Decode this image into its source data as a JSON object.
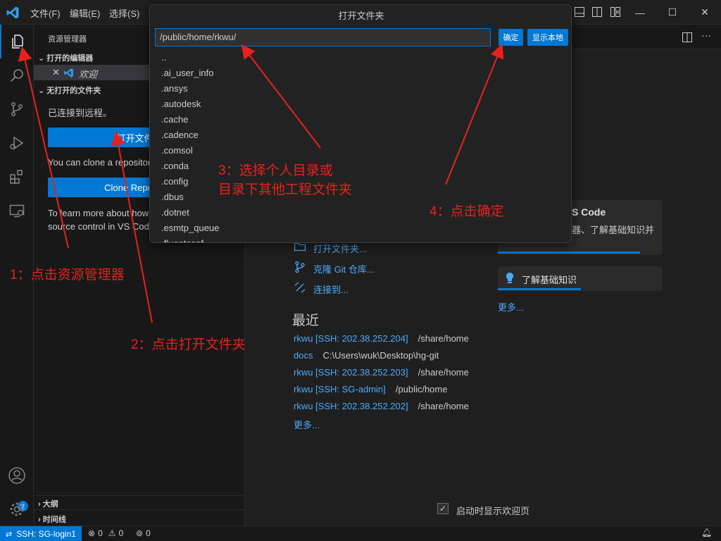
{
  "titlebar": {
    "menus": [
      "文件(F)",
      "编辑(E)",
      "选择(S)"
    ],
    "minimize": "—",
    "maximize": "☐",
    "close": "✕"
  },
  "sidebar": {
    "title": "资源管理器",
    "open_editors": "打开的编辑器",
    "open_editor_item": "欢迎",
    "no_folder": "无打开的文件夹",
    "connected": "已连接到远程。",
    "open_folder_btn": "打开文件夹",
    "clone_text": "You can clone a repository locally.",
    "clone_btn": "Clone Repository",
    "learn_line1": "To learn more about how to use git and",
    "learn_line2": "source control in VS Code",
    "outline": "大纲",
    "timeline": "时间线"
  },
  "welcome": {
    "start_items": [
      "打开文件夹...",
      "克隆 Git 仓库...",
      "连接到..."
    ],
    "recent_heading": "最近",
    "recent": [
      {
        "name": "rkwu [SSH: 202.38.252.204]",
        "path": "/share/home"
      },
      {
        "name": "docs",
        "path": "C:\\Users\\wuk\\Desktop\\hg-git"
      },
      {
        "name": "rkwu [SSH: 202.38.252.203]",
        "path": "/share/home"
      },
      {
        "name": "rkwu [SSH: SG-admin]",
        "path": "/public/home"
      },
      {
        "name": "rkwu [SSH: 202.38.252.202]",
        "path": "/share/home"
      }
    ],
    "more": "更多...",
    "walkthrough_title": "S Code",
    "walkthrough_desc": "器、了解基础知识并",
    "learn_basics": "了解基础知识",
    "walk_more": "更多...",
    "show_on_startup": "启动时显示欢迎页"
  },
  "dialog": {
    "title": "打开文件夹",
    "input_value": "/public/home/rkwu/",
    "ok_btn": "确定",
    "show_local_btn": "显示本地",
    "items": [
      "..",
      ".ai_user_info",
      ".ansys",
      ".autodesk",
      ".cache",
      ".cadence",
      ".comsol",
      ".conda",
      ".config",
      ".dbus",
      ".dotnet",
      ".esmtp_queue",
      ".fluentconf"
    ]
  },
  "statusbar": {
    "remote": "SSH: SG-login1",
    "errors": "0",
    "warnings": "0",
    "ports": "0"
  },
  "annotations": {
    "step1": "1：点击资源管理器",
    "step2": "2：点击打开文件夹",
    "step3_line1": "3：选择个人目录或",
    "step3_line2": "目录下其他工程文件夹",
    "step4": "4：点击确定"
  },
  "colors": {
    "accent": "#0078d4",
    "link": "#4daafc",
    "annotation": "#e8211d"
  }
}
